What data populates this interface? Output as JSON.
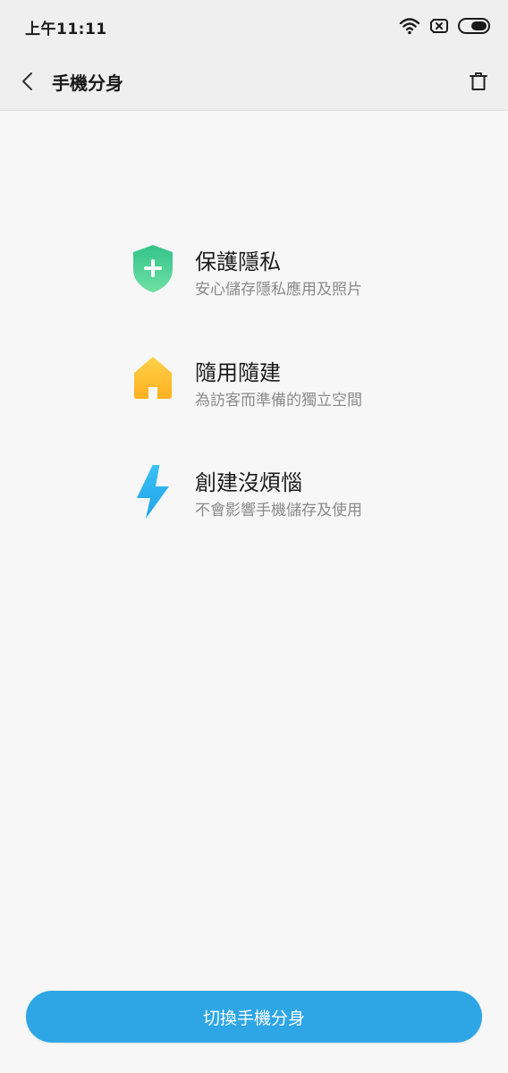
{
  "status_bar": {
    "time": "上午11:11",
    "icons": [
      "wifi-icon",
      "no-sim-icon",
      "battery-icon"
    ]
  },
  "header": {
    "title": "手機分身",
    "back_icon": "chevron-left-icon",
    "delete_icon": "trash-icon"
  },
  "features": [
    {
      "icon": "shield-plus-icon",
      "title": "保護隱私",
      "description": "安心儲存隱私應用及照片",
      "color": "#3fcf8e"
    },
    {
      "icon": "house-icon",
      "title": "隨用隨建",
      "description": "為訪客而準備的獨立空間",
      "color": "#ffc22e"
    },
    {
      "icon": "lightning-icon",
      "title": "創建沒煩惱",
      "description": "不會影響手機儲存及使用",
      "color": "#2fb6f0"
    }
  ],
  "primary_button": {
    "label": "切換手機分身",
    "color": "#2ea6e6"
  }
}
